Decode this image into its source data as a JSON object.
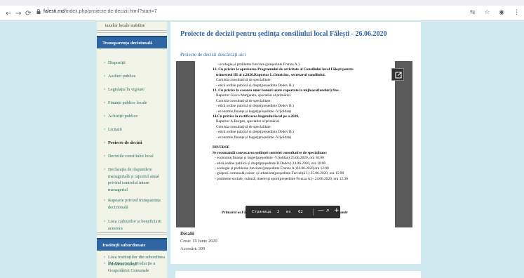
{
  "browser": {
    "url_host": "falesti.md",
    "url_path": "/index.php/proiecte-de-decizii.html?start=7",
    "icons": [
      "back-arrow-icon",
      "forward-arrow-icon",
      "reload-icon",
      "lock-icon",
      "translate-icon",
      "star-icon",
      "profile-icon",
      "menu-icon"
    ]
  },
  "sidebar": {
    "top_text": "taxelor locale stabilite",
    "section1_title": "Transparența decizională",
    "section1_items": [
      {
        "label": "Dispoziții"
      },
      {
        "label": "Audieri publice"
      },
      {
        "label": "Legislația în vigoare"
      },
      {
        "label": "Finanțe publice locale"
      },
      {
        "label": "Achiziții publice"
      },
      {
        "label": "Licitații"
      },
      {
        "label": "Proiecte de decizii"
      },
      {
        "label": "Deciziile consiliului local"
      },
      {
        "label": "Declarația de răspundere managerială și raportul anual privind controlul intern managerial"
      },
      {
        "label": "Rapoarte privind transparența decizională"
      },
      {
        "label": "Lista cadourilor și beneficiarii acestora"
      }
    ],
    "section2_title": "Instituții subordonate",
    "section2_items": [
      {
        "label": "Lista instituțiilor din subordinea Primăriei Fălești"
      },
      {
        "label": "ÎM Direcția de Producție a Gospodăriei Comunale"
      }
    ]
  },
  "main": {
    "title": "Proiecte de decizii pentru ședința consiliului local Fălești - 26.06.2020",
    "download_link": "Proiecte de decizii descărcați aici",
    "pdf_lines": [
      {
        "text": "- ecologie și probleme funciare (președinte Frunza A.)",
        "bold": false
      },
      {
        "text": "12. Cu privire la aprobarea Programului de activitate al Consiliului local Fălești pentru",
        "bold": true
      },
      {
        "text": "trimestrul III al a.2020.Raportor L.Ometciuc, secretarul consiliului.",
        "bold": true
      },
      {
        "text": "Comisia consultativă de specialitate:",
        "bold": false
      },
      {
        "text": "- etică ordine publică și drept(președinte Dedov B.)",
        "bold": false
      },
      {
        "text": "13. Cu privire la casarea unor bunuri uzate raportate la mijloace(fonduri) fixe.",
        "bold": true
      },
      {
        "text": "Raportor Greco Margareta, specialist al primăriei",
        "bold": false
      },
      {
        "text": "Comisia consultativă de specialitate:",
        "bold": false
      },
      {
        "text": "- etică ordine publică și drept(președinte Dedov B.)",
        "bold": false
      },
      {
        "text": "- economie,finanțe și buget(președinte -V.Șoldan)",
        "bold": false
      },
      {
        "text": "14.Cu privire la rectificarea bugetului local pe a.2020.",
        "bold": true
      },
      {
        "text": "Raportor A.Burgan, specialist al primăriei",
        "bold": false
      },
      {
        "text": "Comisia consultativă de specialitate:",
        "bold": false
      },
      {
        "text": "- etică ordine publică și drept(președinte Dedov B.)",
        "bold": false
      },
      {
        "text": "- economie,finanțe și buget(președinte -V.Șoldan)",
        "bold": false
      },
      {
        "text": "",
        "bold": false
      },
      {
        "text": "DIVERSE",
        "bold": true
      },
      {
        "text": "Se recomandă convocarea ședinței comisiei consultative de specialitate:",
        "bold": true
      },
      {
        "text": "- economie,finanțe și buget(președinte -V.Șoldan) 25.06.2020, ora 10:00",
        "bold": false
      },
      {
        "text": "- etică,ordine publică și drept(președinte B.Dedov) 24.06.2020, ora 10:00",
        "bold": false
      },
      {
        "text": "- ecologie și probleme funciare (președinte Frunza A.)24.06.2020,ora 12:00",
        "bold": false
      },
      {
        "text": "- gospod. comunală,constr. și urbanism(președinte Furculiță I.) 25.06.2020, ora 15:00",
        "bold": false
      },
      {
        "text": "- probleme sociale, cultură, tineret și sport(președinte Frunza A.)- 24.06.2020, ora 12:30",
        "bold": false
      }
    ],
    "signature_left": "Primarul or.Fălești",
    "signature_right": "Severin Alexandr",
    "pager": {
      "label": "Страница",
      "current": "2",
      "of": "из",
      "total": "62",
      "zoom_out": "—",
      "zoom_in": "+"
    },
    "details_title": "Detalii",
    "created": "Creat: 19 Iunie 2020",
    "hits": "Accesări: 309"
  }
}
